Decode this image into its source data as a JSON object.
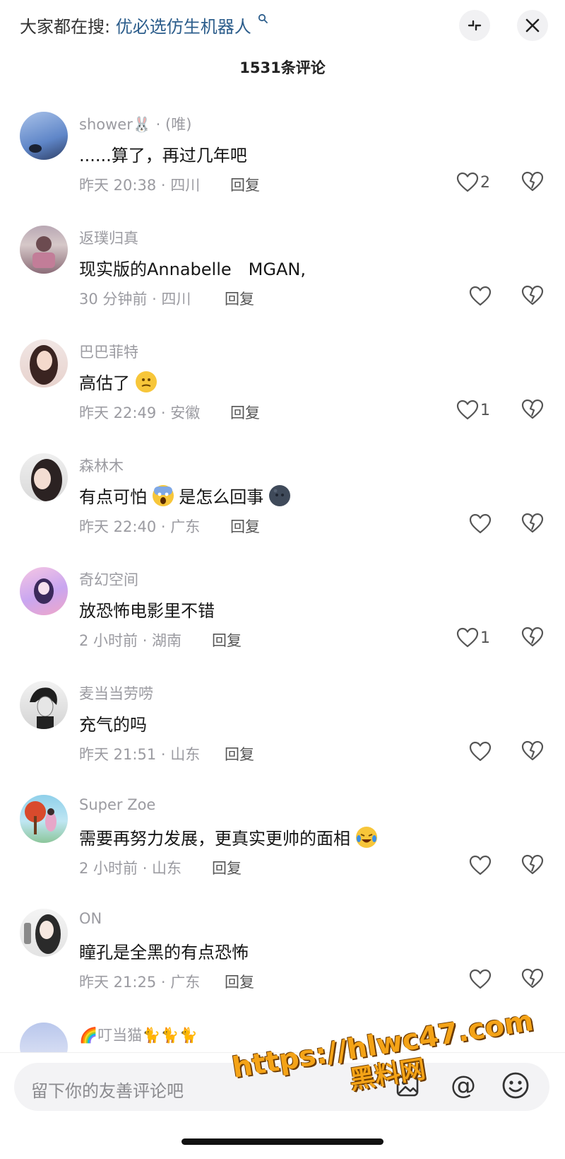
{
  "header": {
    "search_prefix": "大家都在搜:",
    "search_keyword": "优必选仿生机器人",
    "comment_count": "1531条评论"
  },
  "comments": [
    {
      "user": "shower🐰 · (唯)",
      "text": "......算了，再过几年吧",
      "meta": "昨天 20:38 · 四川",
      "reply": "回复",
      "likes": "2"
    },
    {
      "user": "返璞归真",
      "text": "现实版的Annabelle　MGAN,",
      "meta": "30 分钟前 · 四川",
      "reply": "回复",
      "likes": ""
    },
    {
      "user": "巴巴菲特",
      "text": "高估了",
      "meta": "昨天 22:49 · 安徽",
      "reply": "回复",
      "likes": "1"
    },
    {
      "user": "森林木",
      "text_a": "有点可怕",
      "text_b": "是怎么回事",
      "meta": "昨天 22:40 · 广东",
      "reply": "回复",
      "likes": ""
    },
    {
      "user": "奇幻空间",
      "text": "放恐怖电影里不错",
      "meta": "2 小时前 · 湖南",
      "reply": "回复",
      "likes": "1"
    },
    {
      "user": "麦当当劳唠",
      "text": "充气的吗",
      "meta": "昨天 21:51 · 山东",
      "reply": "回复",
      "likes": ""
    },
    {
      "user": "Super Zoe",
      "text": "需要再努力发展，更真实更帅的面相",
      "meta": "2 小时前 · 山东",
      "reply": "回复",
      "likes": ""
    },
    {
      "user": "ON",
      "text": "瞳孔是全黑的有点恐怖",
      "meta": "昨天 21:25 · 广东",
      "reply": "回复",
      "likes": ""
    },
    {
      "user": "🌈叮当猫🐈🐈🐈"
    }
  ],
  "composer": {
    "placeholder": "留下你的友善评论吧",
    "at_symbol": "@"
  },
  "watermark": {
    "line1": "https://hlwc47.com",
    "line2": "黑料网"
  },
  "colors": {
    "keyword": "#2d5e8c",
    "watermark": "#f4a317"
  }
}
